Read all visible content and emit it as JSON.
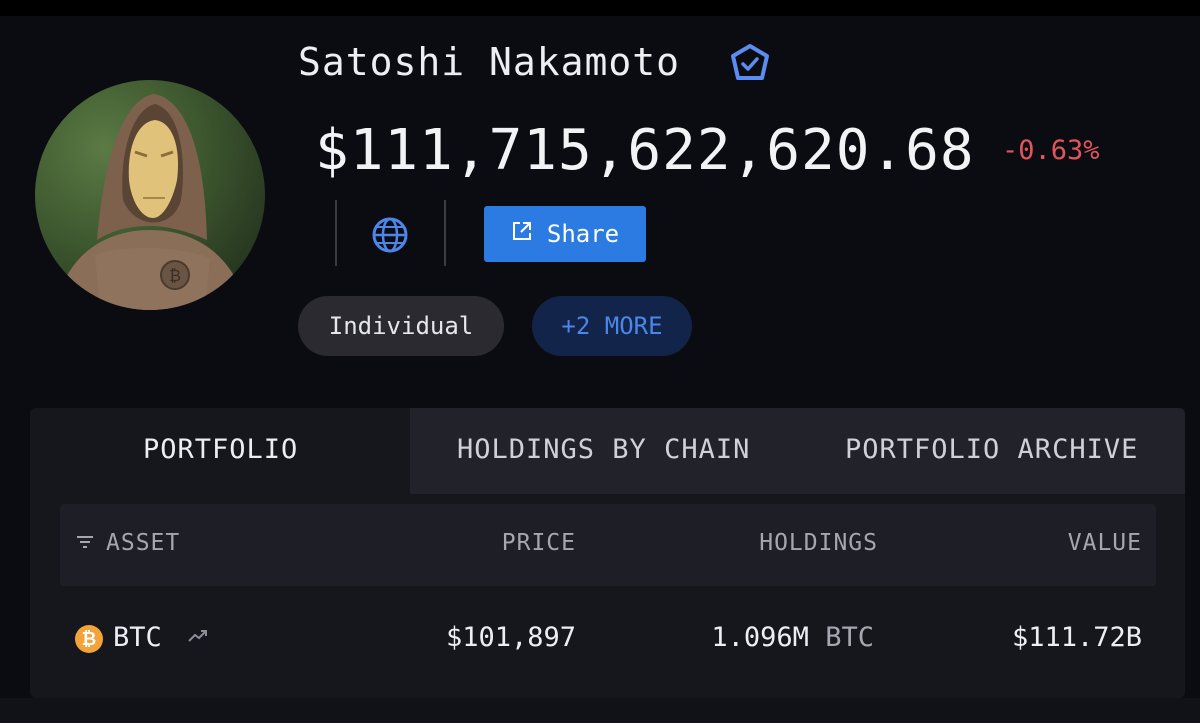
{
  "profile": {
    "name": "Satoshi Nakamoto",
    "total_value": "$111,715,622,620.68",
    "change": "-0.63%",
    "share_label": "Share",
    "tags": [
      "Individual",
      "+2 MORE"
    ]
  },
  "tabs": [
    "PORTFOLIO",
    "HOLDINGS BY CHAIN",
    "PORTFOLIO ARCHIVE"
  ],
  "table": {
    "headers": {
      "asset": "ASSET",
      "price": "PRICE",
      "holdings": "HOLDINGS",
      "value": "VALUE"
    },
    "rows": [
      {
        "asset": "BTC",
        "coin_glyph": "₿",
        "price": "$101,897",
        "holdings": "1.096M",
        "holdings_unit": "BTC",
        "value": "$111.72B"
      }
    ]
  },
  "colors": {
    "accent": "#2b7be3",
    "negative": "#e0545b",
    "btc": "#f2a33a",
    "tag_more": "#4b86e8"
  },
  "icons": [
    "verified-badge-icon",
    "globe-icon",
    "external-link-icon",
    "sort-icon",
    "btc-icon",
    "trend-icon"
  ]
}
